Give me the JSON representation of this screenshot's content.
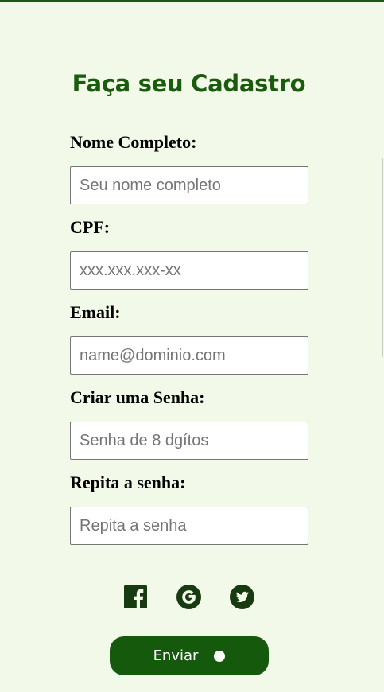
{
  "colors": {
    "background": "#f2f9e8",
    "accent": "#1a5c0e",
    "button": "#155a0c"
  },
  "form": {
    "title": "Faça seu Cadastro",
    "fields": [
      {
        "label": "Nome Completo:",
        "placeholder": "Seu nome completo",
        "value": ""
      },
      {
        "label": "CPF:",
        "placeholder": "xxx.xxx.xxx-xx",
        "value": ""
      },
      {
        "label": "Email:",
        "placeholder": "name@dominio.com",
        "value": ""
      },
      {
        "label": "Criar uma Senha:",
        "placeholder": "Senha de 8 dgítos",
        "value": ""
      },
      {
        "label": "Repita a senha:",
        "placeholder": "Repita a senha",
        "value": ""
      }
    ]
  },
  "social": {
    "icons": [
      "facebook-icon",
      "google-icon",
      "twitter-icon"
    ]
  },
  "submit": {
    "label": "Enviar"
  }
}
